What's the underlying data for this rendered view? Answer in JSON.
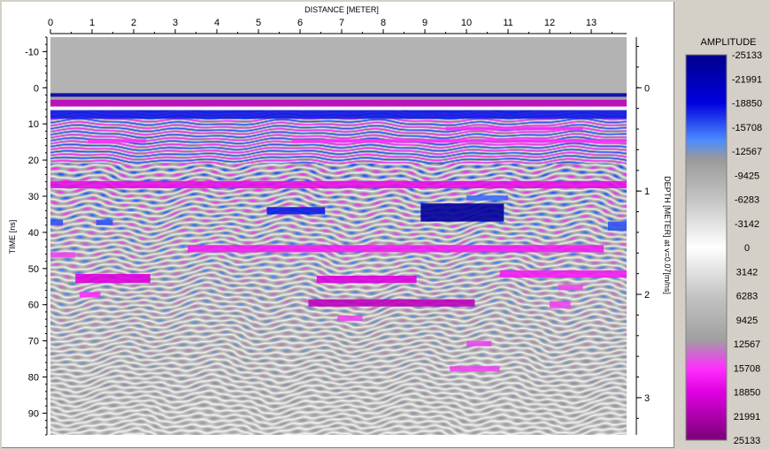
{
  "chart_data": {
    "type": "heatmap",
    "title": "",
    "xlabel": "DISTANCE [METER]",
    "ylabel": "TIME [ns]",
    "y2label": "DEPTH [METER] at v=0.07[m/ns]",
    "x_range": [
      0,
      13.85
    ],
    "y_range": [
      -14,
      96
    ],
    "x_ticks": [
      0,
      1,
      2,
      3,
      4,
      5,
      6,
      7,
      8,
      9,
      10,
      11,
      12,
      13
    ],
    "y_ticks": [
      -10,
      0,
      10,
      20,
      30,
      40,
      50,
      60,
      70,
      80,
      90
    ],
    "depth_range": [
      -0.49,
      3.36
    ],
    "depth_ticks": [
      0,
      1,
      2,
      3
    ],
    "grid": false,
    "legend": {
      "title": "AMPLITUDE",
      "placement": "right",
      "values": [
        -25133,
        -21991,
        -18850,
        -15708,
        -12567,
        -9425,
        -6283,
        -3142,
        0,
        3142,
        6283,
        9425,
        12567,
        15708,
        18850,
        21991,
        25133
      ],
      "colormap": [
        {
          "value": -25133,
          "color": "#00008c"
        },
        {
          "value": -18850,
          "color": "#0000e0"
        },
        {
          "value": -14000,
          "color": "#4c8cff"
        },
        {
          "value": -11500,
          "color": "#9a9a9a"
        },
        {
          "value": -6283,
          "color": "#c4c4c4"
        },
        {
          "value": 0,
          "color": "#ffffff"
        },
        {
          "value": 6283,
          "color": "#c4c4c4"
        },
        {
          "value": 12000,
          "color": "#a0a0a0"
        },
        {
          "value": 15708,
          "color": "#ff30ff"
        },
        {
          "value": 18850,
          "color": "#e000e0"
        },
        {
          "value": 25133,
          "color": "#7a0078"
        }
      ]
    },
    "reflectors": [
      {
        "t_start": -14,
        "t_end": 1.5,
        "x_start": 0,
        "x_end": 13.85,
        "amplitude": 9000
      },
      {
        "t_start": 1.5,
        "t_end": 2.5,
        "x_start": 0,
        "x_end": 13.85,
        "amplitude": -23000
      },
      {
        "t_start": 2.5,
        "t_end": 3.3,
        "x_start": 0,
        "x_end": 13.85,
        "amplitude": 12000
      },
      {
        "t_start": 3.3,
        "t_end": 5.2,
        "x_start": 0,
        "x_end": 13.85,
        "amplitude": 21000
      },
      {
        "t_start": 5.2,
        "t_end": 6.2,
        "x_start": 0,
        "x_end": 13.85,
        "amplitude": 0
      },
      {
        "t_start": 6.2,
        "t_end": 8.6,
        "x_start": 0,
        "x_end": 13.85,
        "amplitude": -18000
      },
      {
        "t_start": 10.8,
        "t_end": 11.8,
        "x_start": 9.5,
        "x_end": 12.8,
        "amplitude": 16000
      },
      {
        "t_start": 14.2,
        "t_end": 15.2,
        "x_start": 0.9,
        "x_end": 2.3,
        "amplitude": 16000
      },
      {
        "t_start": 14.2,
        "t_end": 15.2,
        "x_start": 5.8,
        "x_end": 13.85,
        "amplitude": 16000
      },
      {
        "t_start": 25.8,
        "t_end": 27.8,
        "x_start": 0,
        "x_end": 13.85,
        "amplitude": 18000
      },
      {
        "t_start": 29.8,
        "t_end": 31.2,
        "x_start": 10,
        "x_end": 11,
        "amplitude": -15000
      },
      {
        "t_start": 33,
        "t_end": 35,
        "x_start": 5.2,
        "x_end": 6.6,
        "amplitude": -18000
      },
      {
        "t_start": 32,
        "t_end": 37,
        "x_start": 8.9,
        "x_end": 10.9,
        "amplitude": -24000
      },
      {
        "t_start": 36.5,
        "t_end": 38,
        "x_start": 0,
        "x_end": 0.3,
        "amplitude": -16000
      },
      {
        "t_start": 36.5,
        "t_end": 38,
        "x_start": 1.1,
        "x_end": 1.5,
        "amplitude": -16000
      },
      {
        "t_start": 37,
        "t_end": 39.5,
        "x_start": 13.4,
        "x_end": 13.85,
        "amplitude": -16000
      },
      {
        "t_start": 43.5,
        "t_end": 45.5,
        "x_start": 3.3,
        "x_end": 13.3,
        "amplitude": 17000
      },
      {
        "t_start": 45.5,
        "t_end": 47,
        "x_start": 0,
        "x_end": 0.6,
        "amplitude": 15000
      },
      {
        "t_start": 50.5,
        "t_end": 52.5,
        "x_start": 10.8,
        "x_end": 13.85,
        "amplitude": 17000
      },
      {
        "t_start": 51.5,
        "t_end": 54,
        "x_start": 0.6,
        "x_end": 2.4,
        "amplitude": 19000
      },
      {
        "t_start": 52,
        "t_end": 54,
        "x_start": 6.4,
        "x_end": 8.8,
        "amplitude": 19000
      },
      {
        "t_start": 54.5,
        "t_end": 56,
        "x_start": 12.2,
        "x_end": 12.8,
        "amplitude": 15000
      },
      {
        "t_start": 56.5,
        "t_end": 58,
        "x_start": 0.7,
        "x_end": 1.2,
        "amplitude": 16000
      },
      {
        "t_start": 58.5,
        "t_end": 60.5,
        "x_start": 6.2,
        "x_end": 10.2,
        "amplitude": 21000
      },
      {
        "t_start": 59,
        "t_end": 61,
        "x_start": 12,
        "x_end": 12.5,
        "amplitude": 15000
      },
      {
        "t_start": 63,
        "t_end": 64.5,
        "x_start": 6.9,
        "x_end": 7.5,
        "amplitude": 15000
      },
      {
        "t_start": 70,
        "t_end": 71.5,
        "x_start": 10,
        "x_end": 10.6,
        "amplitude": 15000
      },
      {
        "t_start": 77,
        "t_end": 78.5,
        "x_start": 9.6,
        "x_end": 10.8,
        "amplitude": 15000
      }
    ]
  }
}
